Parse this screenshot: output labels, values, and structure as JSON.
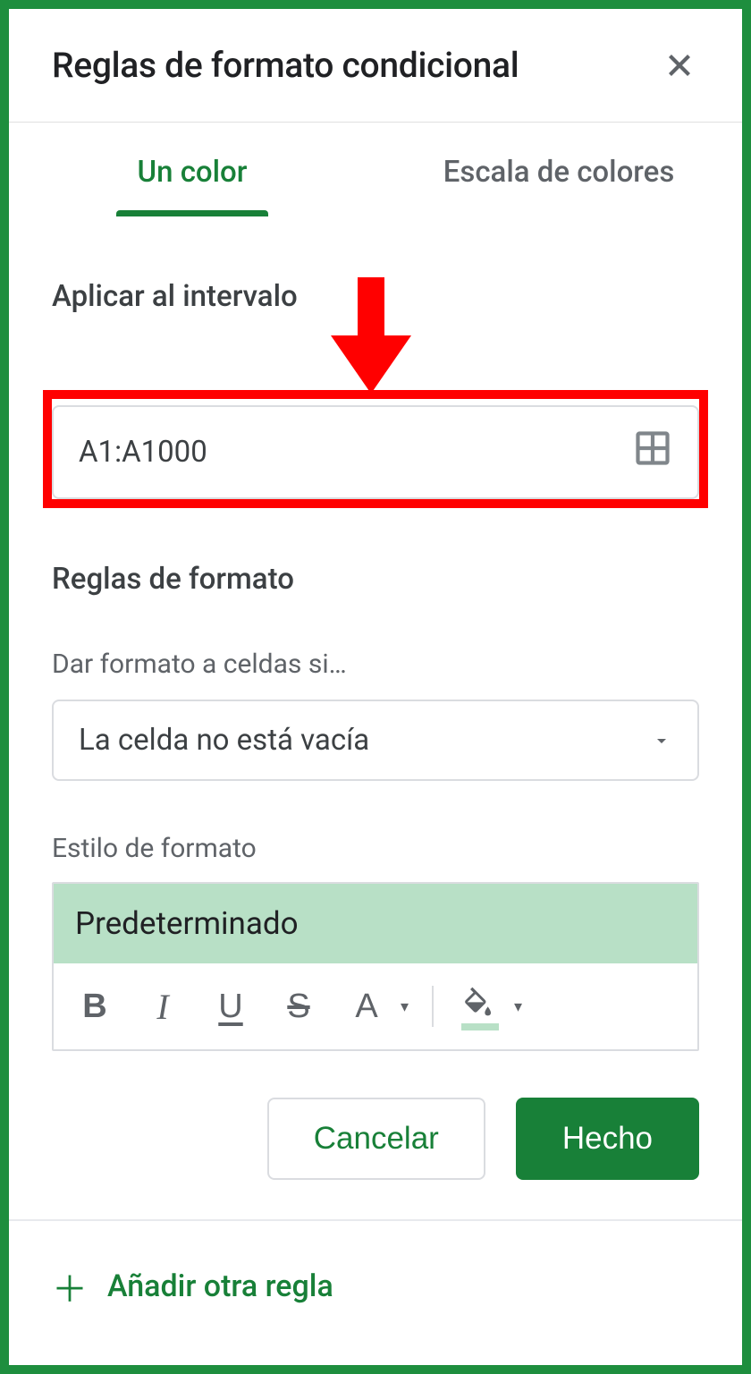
{
  "header": {
    "title": "Reglas de formato condicional"
  },
  "tabs": {
    "single": "Un color",
    "scale": "Escala de colores"
  },
  "range": {
    "label": "Aplicar al intervalo",
    "value": "A1:A1000"
  },
  "rules": {
    "heading": "Reglas de formato",
    "condition_label": "Dar formato a celdas si…",
    "condition_value": "La celda no está vacía",
    "style_label": "Estilo de formato",
    "style_name": "Predeterminado"
  },
  "buttons": {
    "cancel": "Cancelar",
    "done": "Hecho"
  },
  "add_rule": "Añadir otra regla",
  "toolbar": {
    "bold": "B",
    "italic": "I",
    "underline": "U",
    "strike": "S",
    "textcolor": "A"
  },
  "colors": {
    "accent": "#188038",
    "highlight_fill": "#b8e0c6",
    "annotation": "#ff0000"
  }
}
